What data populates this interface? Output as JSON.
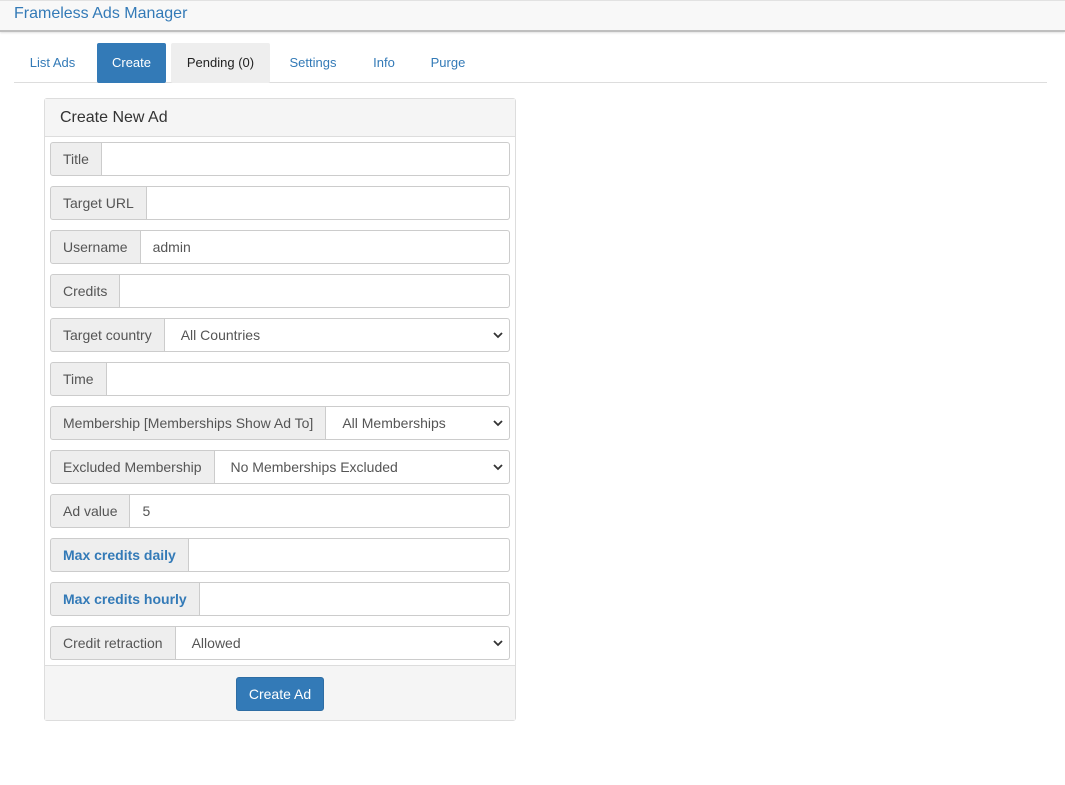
{
  "app": {
    "title": "Frameless Ads Manager"
  },
  "tabs": [
    {
      "label": "List Ads"
    },
    {
      "label": "Create"
    },
    {
      "label": "Pending (0)"
    },
    {
      "label": "Settings"
    },
    {
      "label": "Info"
    },
    {
      "label": "Purge"
    }
  ],
  "active_tab": "Create",
  "form": {
    "heading": "Create New Ad",
    "fields": [
      {
        "label": "Title",
        "value": ""
      },
      {
        "label": "Target URL",
        "value": ""
      },
      {
        "label": "Username",
        "value": "admin"
      },
      {
        "label": "Credits",
        "value": ""
      },
      {
        "label": "Target country",
        "value": "All Countries"
      },
      {
        "label": "Time",
        "value": ""
      },
      {
        "label": "Membership [Memberships Show Ad To]",
        "value": "All Memberships"
      },
      {
        "label": "Excluded Membership",
        "value": "No Memberships Excluded"
      },
      {
        "label": "Ad value",
        "value": "5"
      },
      {
        "label": "Max credits daily",
        "value": ""
      },
      {
        "label": "Max credits hourly",
        "value": ""
      },
      {
        "label": "Credit retraction",
        "value": "Allowed"
      }
    ],
    "submit_label": "Create Ad"
  },
  "colors": {
    "accent": "#337ab7",
    "panel_bg": "#f5f5f5",
    "addon_bg": "#eeeeee",
    "border": "#cccccc"
  },
  "icons": {
    "select_arrow": "chevron-down-icon"
  }
}
